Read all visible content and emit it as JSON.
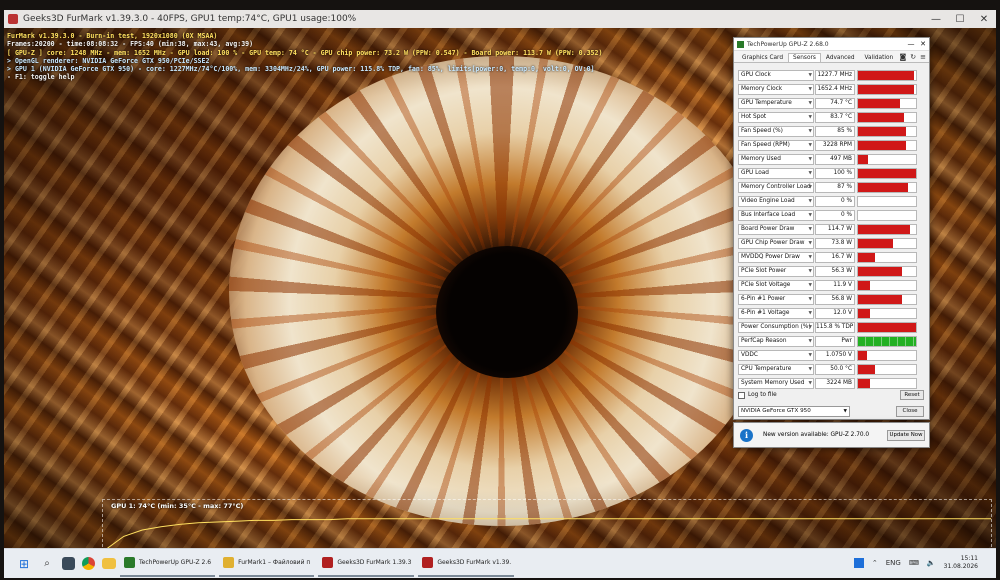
{
  "furmark": {
    "window_title": "Geeks3D FurMark v1.39.3.0 - 40FPS, GPU1 temp:74°C, GPU1 usage:100%",
    "overlay_lines": [
      "FurMark v1.39.3.0 - Burn-in test, 1920x1080 (0X MSAA)",
      "Frames:20200 - time:08:08:32 - FPS:40 (min:38, max:43, avg:39)",
      "[ GPU-Z ] core: 1248 MHz - mem: 1652 MHz - GPU load: 100 % - GPU temp: 74 °C - GPU chip power: 73.2 W (PPW: 0.547) - Board power: 113.7 W (PPW: 0.352)",
      "> OpenGL renderer: NVIDIA GeForce GTX 950/PCIe/SSE2",
      "> GPU 1 (NVIDIA GeForce GTX 950) - core: 1227MHz/74°C/100%, mem: 3304MHz/24%, GPU power: 115.8% TDP, fan: 85%, limits[power:0, temp:0, volt:0, OV:0]",
      "- F1: toggle help"
    ],
    "graph_label": "GPU 1: 74°C (min: 35°C - max: 77°C)",
    "graph_temps": [
      35,
      52,
      60,
      64,
      67,
      69,
      70,
      71,
      72,
      72,
      73,
      73,
      73,
      74,
      74,
      74,
      74,
      74,
      74,
      74,
      74,
      74,
      74,
      74,
      74
    ]
  },
  "gpuz": {
    "title": "TechPowerUp GPU-Z 2.68.0",
    "tabs": [
      "Graphics Card",
      "Sensors",
      "Advanced",
      "Validation"
    ],
    "active_tab": "Sensors",
    "tool_icons": [
      "camera-icon",
      "refresh-icon",
      "menu-icon"
    ],
    "sensors": [
      {
        "name": "GPU Clock",
        "value": "1227.7 MHz",
        "fill": 0.97,
        "color": "red"
      },
      {
        "name": "Memory Clock",
        "value": "1652.4 MHz",
        "fill": 0.97,
        "color": "red"
      },
      {
        "name": "GPU Temperature",
        "value": "74.7 °C",
        "fill": 0.72,
        "color": "red"
      },
      {
        "name": "Hot Spot",
        "value": "83.7 °C",
        "fill": 0.8,
        "color": "red"
      },
      {
        "name": "Fan Speed (%)",
        "value": "85 %",
        "fill": 0.82,
        "color": "red"
      },
      {
        "name": "Fan Speed (RPM)",
        "value": "3228 RPM",
        "fill": 0.82,
        "color": "red"
      },
      {
        "name": "Memory Used",
        "value": "497 MB",
        "fill": 0.18,
        "color": "red"
      },
      {
        "name": "GPU Load",
        "value": "100 %",
        "fill": 1.0,
        "color": "red"
      },
      {
        "name": "Memory Controller Load",
        "value": "87 %",
        "fill": 0.87,
        "color": "red"
      },
      {
        "name": "Video Engine Load",
        "value": "0 %",
        "fill": 0.0,
        "color": "red"
      },
      {
        "name": "Bus Interface Load",
        "value": "0 %",
        "fill": 0.0,
        "color": "red"
      },
      {
        "name": "Board Power Draw",
        "value": "114.7 W",
        "fill": 0.9,
        "color": "red"
      },
      {
        "name": "GPU Chip Power Draw",
        "value": "73.8 W",
        "fill": 0.6,
        "color": "red"
      },
      {
        "name": "MVDDQ Power Draw",
        "value": "16.7 W",
        "fill": 0.3,
        "color": "red"
      },
      {
        "name": "PCIe Slot Power",
        "value": "56.3 W",
        "fill": 0.75,
        "color": "red"
      },
      {
        "name": "PCIe Slot Voltage",
        "value": "11.9 V",
        "fill": 0.2,
        "color": "red"
      },
      {
        "name": "6-Pin #1 Power",
        "value": "56.8 W",
        "fill": 0.75,
        "color": "red"
      },
      {
        "name": "6-Pin #1 Voltage",
        "value": "12.0 V",
        "fill": 0.2,
        "color": "red"
      },
      {
        "name": "Power Consumption (%)",
        "value": "115.8 % TDP",
        "fill": 1.0,
        "color": "red"
      },
      {
        "name": "PerfCap Reason",
        "value": "Pwr",
        "fill": 1.0,
        "color": "green"
      },
      {
        "name": "VDDC",
        "value": "1.0750 V",
        "fill": 0.15,
        "color": "red"
      },
      {
        "name": "CPU Temperature",
        "value": "50.0 °C",
        "fill": 0.3,
        "color": "red"
      },
      {
        "name": "System Memory Used",
        "value": "3224 MB",
        "fill": 0.2,
        "color": "red"
      }
    ],
    "log_to_file": "Log to file",
    "reset": "Reset",
    "gpu_select": "NVIDIA GeForce GTX 950",
    "close": "Close"
  },
  "notify": {
    "message": "New version available: GPU-Z 2.70.0",
    "button": "Update Now"
  },
  "taskbar": {
    "apps": [
      {
        "label": "TechPowerUp GPU-Z 2.6",
        "color": "#2a7a2a"
      },
      {
        "label": "FurMark1 – Файловий п",
        "color": "#e0b030"
      },
      {
        "label": "Geeks3D FurMark 1.39.3",
        "color": "#b02020"
      },
      {
        "label": "Geeks3D FurMark v1.39.",
        "color": "#b02020"
      }
    ],
    "lang": "ENG",
    "time": "15:11",
    "date": "31.08.2026"
  }
}
